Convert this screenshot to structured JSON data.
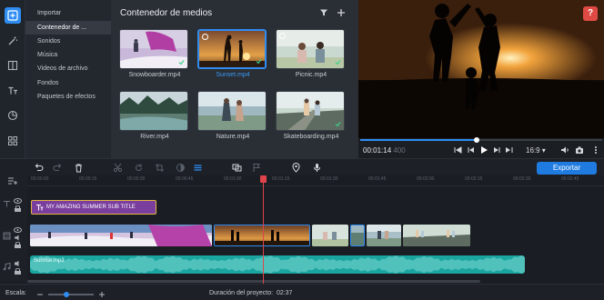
{
  "rail": {
    "items": [
      {
        "icon": "import-plus-icon",
        "active": true
      },
      {
        "icon": "magic-wand-icon"
      },
      {
        "icon": "transitions-icon"
      },
      {
        "icon": "titles-icon"
      },
      {
        "icon": "stickers-icon"
      },
      {
        "icon": "more-tools-icon"
      }
    ],
    "accent": "#2f8df2"
  },
  "categories": {
    "items": [
      {
        "label": "Importar"
      },
      {
        "label": "Contenedor de ..."
      },
      {
        "label": "Sonidos"
      },
      {
        "label": "Música"
      },
      {
        "label": "Videos de archivo"
      },
      {
        "label": "Fondos"
      },
      {
        "label": "Paquetes de efectos"
      }
    ],
    "active_index": 1
  },
  "media": {
    "title": "Contenedor de medios",
    "filter_icon": "filter-icon",
    "add_icon": "plus-icon",
    "items": [
      {
        "label": "Snowboarder.mp4",
        "checked": true
      },
      {
        "label": "Sunset.mp4",
        "checked": true,
        "selected": true
      },
      {
        "label": "Picnic.mp4",
        "checked": true
      },
      {
        "label": "River.mp4",
        "checked": false
      },
      {
        "label": "Nature.mp4",
        "checked": false
      },
      {
        "label": "Skateboarding.mp4",
        "checked": true
      }
    ]
  },
  "preview": {
    "help_label": "?",
    "time_current": "00:01:14",
    "time_frames": "400",
    "progress": 0.48,
    "aspect_ratio": "16:9"
  },
  "toolbar": {
    "export_label": "Exportar"
  },
  "timeline": {
    "ruler_labels": [
      "00:00:00",
      "00:00:15",
      "00:00:30",
      "00:00:45",
      "00:01:00",
      "00:01:15",
      "00:01:30",
      "00:01:45",
      "00:02:00",
      "00:02:15",
      "00:02:30",
      "00:02:45"
    ],
    "title_clip": "MY AMAZING SUMMER SUB TITLE",
    "audio_clip": "Sunrise.mp3"
  },
  "status": {
    "zoom_label": "Escala:",
    "zoom_value": 0.4,
    "duration_label": "Duración del proyecto:",
    "duration_value": "02:37"
  }
}
